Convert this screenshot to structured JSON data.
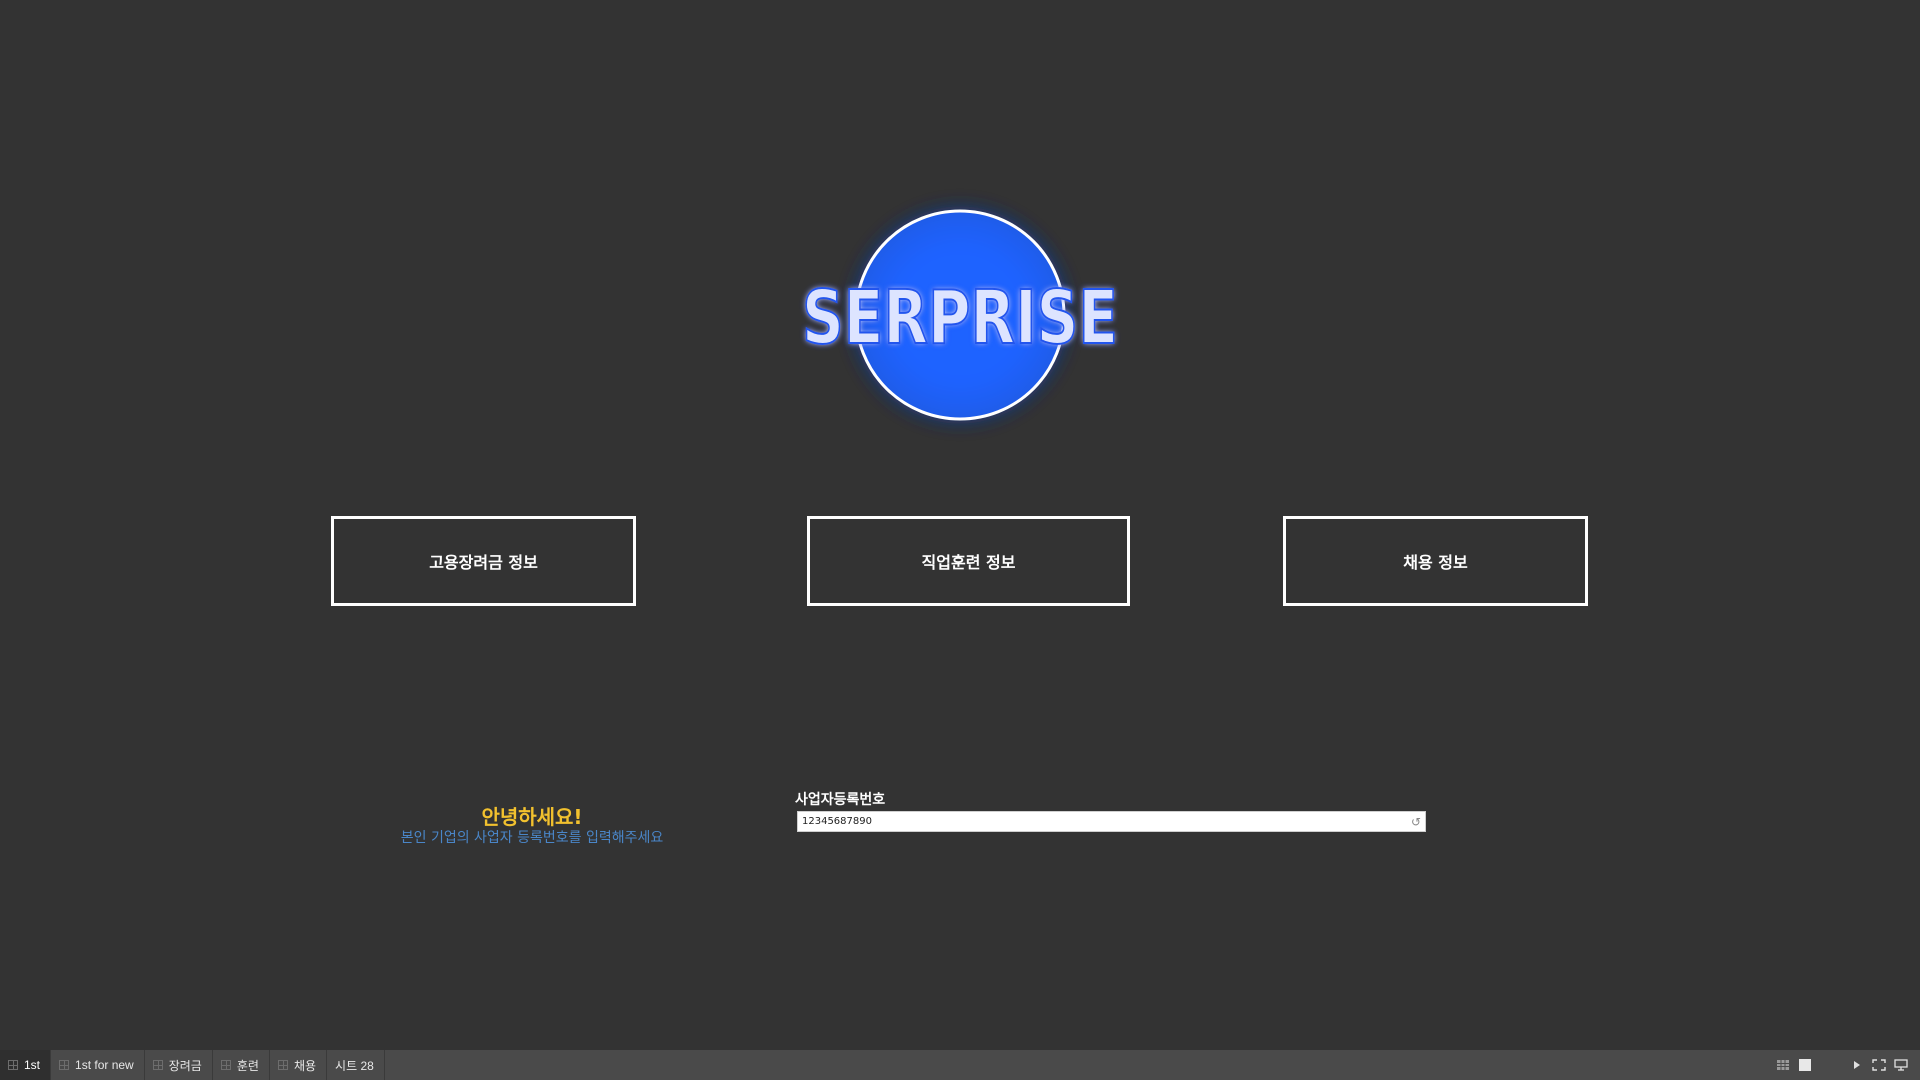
{
  "logo": {
    "text": "SERPRISE",
    "glow_color": "#1e63ff"
  },
  "nav": {
    "subsidy_label": "고용장려금 정보",
    "training_label": "직업훈련 정보",
    "recruit_label": "채용 정보"
  },
  "greeting": {
    "title": "안녕하세요!",
    "subtitle": "본인 기업의 사업자 등록번호를 입력해주세요",
    "title_color": "#f2c12e",
    "subtitle_color": "#4a86c8"
  },
  "bizno": {
    "label": "사업자등록번호",
    "value": "12345687890"
  },
  "tabs": [
    {
      "label": "1st",
      "active": true
    },
    {
      "label": "1st for new",
      "active": false
    },
    {
      "label": "장려금",
      "active": false
    },
    {
      "label": "훈련",
      "active": false
    },
    {
      "label": "채용",
      "active": false
    },
    {
      "label": "시트 28",
      "active": false
    }
  ],
  "controls": {
    "icons": [
      "grid-view-icon",
      "page-view-icon",
      "play-icon",
      "fullscreen-icon",
      "presentation-icon"
    ]
  }
}
